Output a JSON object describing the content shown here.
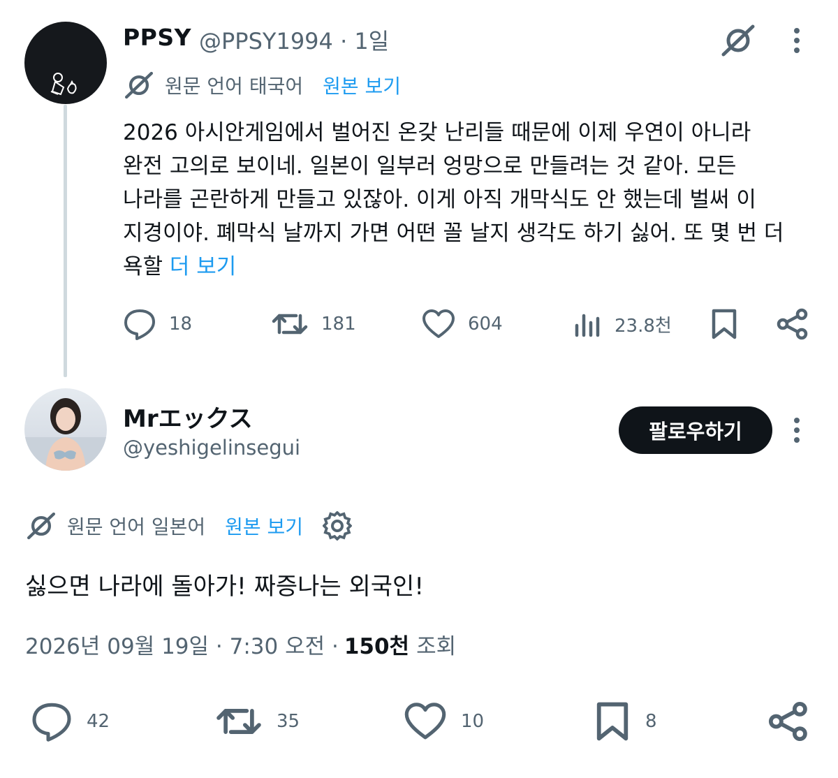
{
  "tweet1": {
    "display_name": "PPSY",
    "handle_time": "@PPSY1994 · 1일",
    "translation": {
      "source_language": "원문 언어 태국어",
      "view_original": "원본 보기"
    },
    "text_lines": [
      "2026 아시안게임에서 벌어진 온갖 난리들 때문에 이제 우연이 아니라",
      "완전 고의로 보이네. 일본이 일부러 엉망으로 만들려는 것 같아. 모든",
      "나라를 곤란하게 만들고 있잖아. 이게 아직 개막식도 안 했는데 벌써 이",
      "지경이야. 폐막식 날까지 가면 어떤 꼴 날지 생각도 하기 싫어. 또 몇 번 더"
    ],
    "last_line_text": "욕할",
    "show_more": "더 보기",
    "actions": {
      "replies": "18",
      "reposts": "181",
      "likes": "604",
      "views": "23.8천"
    }
  },
  "tweet2": {
    "display_name": "Mrエックス",
    "handle": "@yeshigelinsegui",
    "follow_label": "팔로우하기",
    "translation": {
      "source_language": "원문 언어 일본어",
      "view_original": "원본 보기"
    },
    "text": "싫으면 나라에 돌아가! 짜증나는 외국인!",
    "timestamp": "2026년 09월 19일 · 7:30 오전 ·",
    "views_count": "150천",
    "views_label": "조회",
    "actions": {
      "replies": "42",
      "reposts": "35",
      "likes": "10",
      "bookmarks": "8"
    }
  },
  "colors": {
    "text": "#0f1419",
    "secondary": "#536471",
    "link": "#1d9bf0",
    "thread_line": "#cfd9de"
  },
  "icons": [
    "grok-icon",
    "more-icon",
    "translate-icon",
    "reply-icon",
    "repost-icon",
    "like-icon",
    "views-icon",
    "bookmark-icon",
    "share-icon",
    "settings-icon"
  ]
}
